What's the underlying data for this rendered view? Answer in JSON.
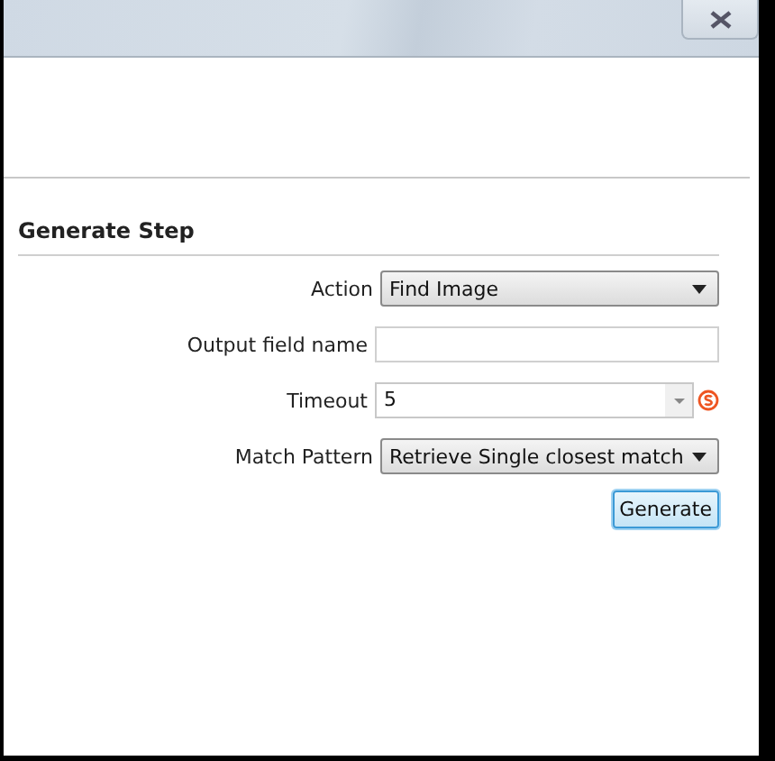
{
  "section": {
    "title": "Generate Step"
  },
  "fields": [
    {
      "kind": "dropdown",
      "label": "Action",
      "value": "Find Image"
    },
    {
      "kind": "text",
      "label": "Output field name"
    },
    {
      "kind": "spinner",
      "label": "Timeout",
      "value": "5"
    },
    {
      "kind": "dropdown",
      "label": "Match Pattern",
      "value": "Retrieve Single closest match"
    }
  ],
  "buttons": [
    {
      "label": "Generate",
      "focused": true
    }
  ]
}
